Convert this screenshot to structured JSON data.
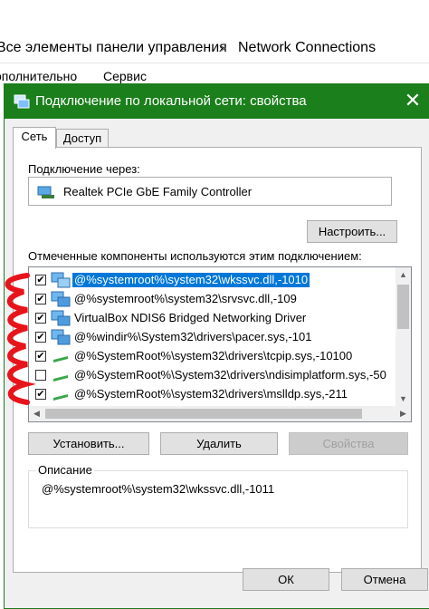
{
  "background_window": {
    "breadcrumb_item1": "Все элементы панели управления",
    "breadcrumb_separator": ">",
    "breadcrumb_item2": "Network Connections",
    "menu_item1": "ополнительно",
    "menu_item2": "Сервис"
  },
  "dialog": {
    "title": "Подключение по локальной сети: свойства",
    "close_glyph": "✕",
    "tabs": [
      {
        "label": "Сеть"
      },
      {
        "label": "Доступ"
      }
    ],
    "connect_using_label": "Подключение через:",
    "adapter_name": "Realtek PCIe GbE Family Controller",
    "configure_button": "Настроить...",
    "components_label": "Отмеченные компоненты используются этим подключением:",
    "components": [
      {
        "label": "@%systemroot%\\system32\\wkssvc.dll,-1010",
        "checked": true,
        "selected": true,
        "icon": "network-client-icon"
      },
      {
        "label": "@%systemroot%\\system32\\srvsvc.dll,-109",
        "checked": true,
        "selected": false,
        "icon": "network-service-icon"
      },
      {
        "label": "VirtualBox NDIS6 Bridged Networking Driver",
        "checked": true,
        "selected": false,
        "icon": "network-service-icon"
      },
      {
        "label": "@%windir%\\System32\\drivers\\pacer.sys,-101",
        "checked": true,
        "selected": false,
        "icon": "network-service-icon"
      },
      {
        "label": "@%SystemRoot%\\system32\\drivers\\tcpip.sys,-10100",
        "checked": true,
        "selected": false,
        "icon": "protocol-icon"
      },
      {
        "label": "@%SystemRoot%\\System32\\drivers\\ndisimplatform.sys,-50",
        "checked": false,
        "selected": false,
        "icon": "protocol-icon"
      },
      {
        "label": "@%SystemRoot%\\system32\\drivers\\mslldp.sys,-211",
        "checked": true,
        "selected": false,
        "icon": "protocol-icon"
      }
    ],
    "install_button": "Установить...",
    "uninstall_button": "Удалить",
    "properties_button": "Свойства",
    "description_legend": "Описание",
    "description_text": "@%systemroot%\\system32\\wkssvc.dll,-1011",
    "ok_button": "ОК",
    "cancel_button": "Отмена",
    "check_glyph": "✔",
    "scroll_up_glyph": "▲",
    "scroll_down_glyph": "▼",
    "scroll_left_glyph": "◀",
    "scroll_right_glyph": "▶"
  },
  "colors": {
    "titlebar": "#1b7f1b",
    "selection": "#0078d7",
    "annotation_red": "#e8141c"
  }
}
